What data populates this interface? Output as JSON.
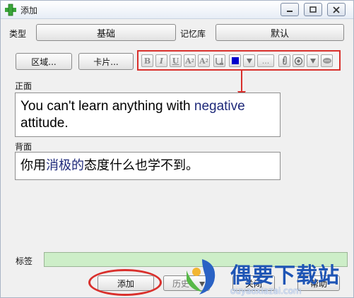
{
  "window": {
    "title": "添加"
  },
  "top_row": {
    "type_label": "类型",
    "type_value": "基础",
    "deck_label": "记忆库",
    "deck_value": "默认"
  },
  "toolbar": {
    "region_label": "区域...",
    "card_label": "卡片...",
    "bold": "B",
    "italic": "I",
    "underline": "U",
    "superscript": "A",
    "subscript": "A",
    "more_label": "...",
    "text_color": "#0000cc"
  },
  "front": {
    "label": "正面",
    "line1_a": "You can't learn anything with ",
    "line1_kw": "negative",
    "line2": "attitude."
  },
  "back": {
    "label": "背面",
    "text_a": "你用",
    "text_kw": "消极的",
    "text_b": "态度什么也学不到。"
  },
  "tags": {
    "label": "标签",
    "value": ""
  },
  "bottom": {
    "add_label": "添加",
    "history_label": "历史",
    "close_label": "关闭",
    "help_label": "帮助"
  },
  "watermark": {
    "title": "偶要下载站",
    "url": "ouyaoxiazai.com"
  },
  "colors": {
    "highlight_red": "#d9302c",
    "keyword_blue": "#1f2a7a",
    "tag_green": "#cdeec8"
  }
}
